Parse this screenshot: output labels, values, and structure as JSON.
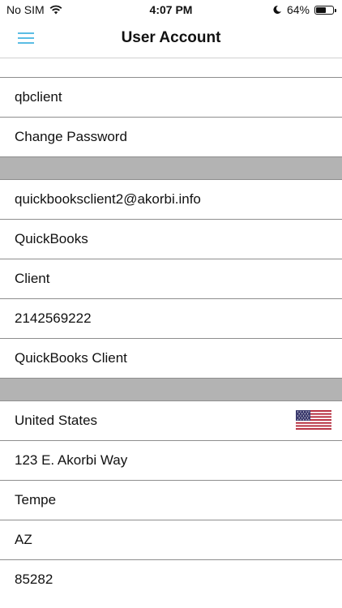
{
  "status_bar": {
    "carrier": "No SIM",
    "time": "4:07 PM",
    "battery_percent": "64%",
    "battery_level": 0.64
  },
  "nav": {
    "title": "User Account",
    "accent_color": "#5bbde4"
  },
  "account_section": {
    "username": "qbclient",
    "change_password_label": "Change Password"
  },
  "profile_section": {
    "email": "quickbooksclient2@akorbi.info",
    "first_name": "QuickBooks",
    "last_name": "Client",
    "phone": "2142569222",
    "display_name": "QuickBooks Client"
  },
  "address_section": {
    "country": "United States",
    "country_flag_icon": "us-flag-icon",
    "street": "123 E. Akorbi Way",
    "city": "Tempe",
    "state": "AZ",
    "zip": "85282"
  }
}
